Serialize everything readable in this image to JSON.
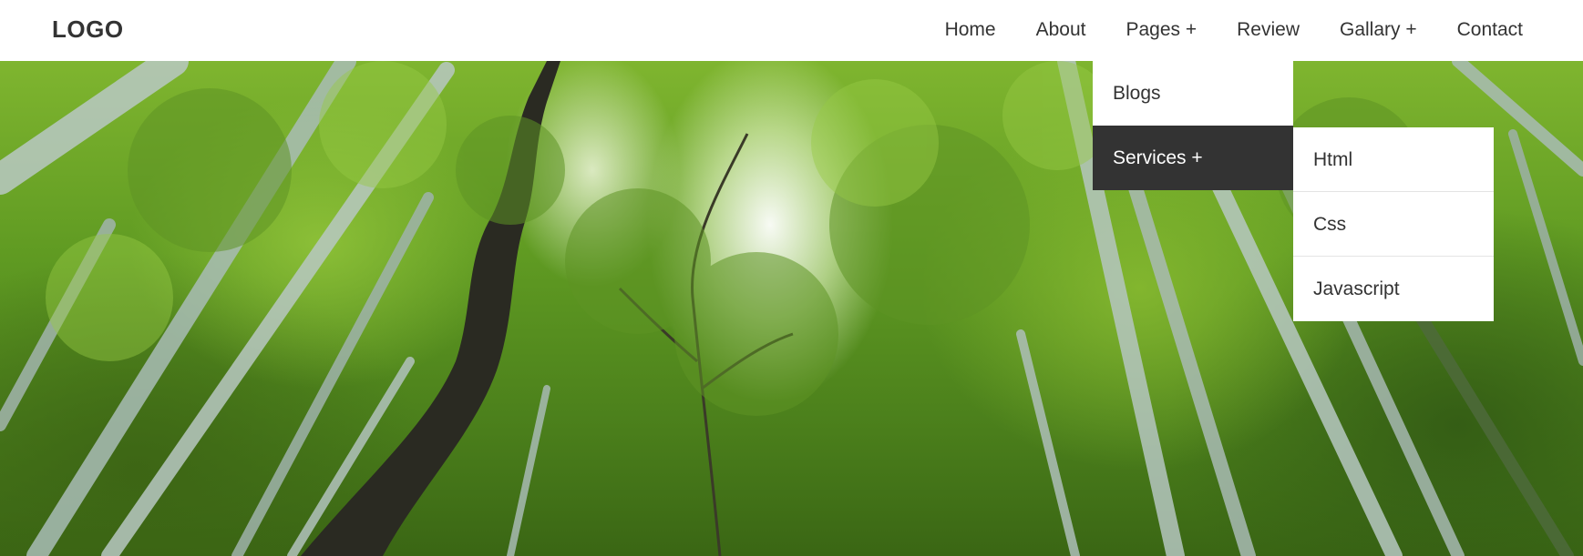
{
  "header": {
    "logo": "LOGO"
  },
  "nav": {
    "items": [
      {
        "label": "Home"
      },
      {
        "label": "About"
      },
      {
        "label": "Pages +"
      },
      {
        "label": "Review"
      },
      {
        "label": "Gallary +"
      },
      {
        "label": "Contact"
      }
    ]
  },
  "pages_dropdown": {
    "items": [
      {
        "label": "Blogs"
      },
      {
        "label": "Services +",
        "active": true
      }
    ]
  },
  "services_submenu": {
    "items": [
      {
        "label": "Html"
      },
      {
        "label": "Css"
      },
      {
        "label": "Javascript"
      }
    ]
  },
  "hero": {
    "image": "bamboo forest canopy photo"
  },
  "colors": {
    "nav_bg": "#ffffff",
    "text": "#333333",
    "active_bg": "#333333",
    "active_text": "#ffffff"
  }
}
